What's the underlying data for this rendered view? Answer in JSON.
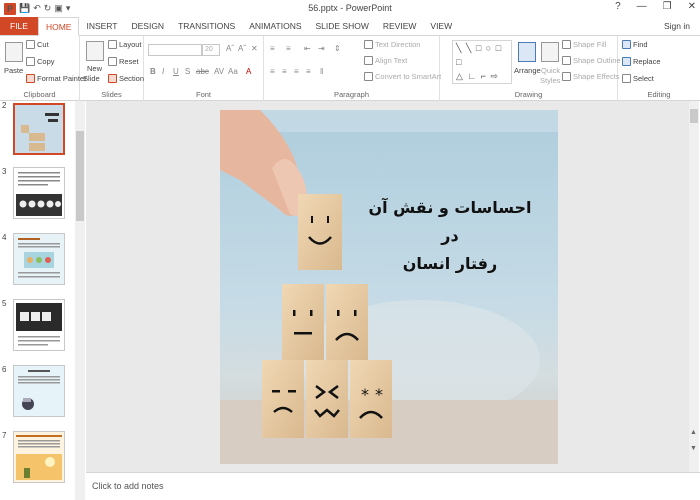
{
  "app": {
    "window_title": "56.pptx - PowerPoint",
    "logo_letter": "P",
    "controls": [
      "?",
      "—",
      "❐",
      "✕"
    ]
  },
  "tabs": [
    "FILE",
    "HOME",
    "INSERT",
    "DESIGN",
    "TRANSITIONS",
    "ANIMATIONS",
    "SLIDE SHOW",
    "REVIEW",
    "VIEW"
  ],
  "active_tab": "HOME",
  "signin": "Sign in",
  "ribbon": {
    "clipboard": {
      "paste": "Paste",
      "cut": "Cut",
      "copy": "Copy",
      "format_painter": "Format Painter",
      "label": "Clipboard"
    },
    "slides": {
      "new_slide": "New",
      "new_slide2": "Slide",
      "layout": "Layout",
      "reset": "Reset",
      "section": "Section",
      "label": "Slides"
    },
    "font": {
      "size": "20",
      "label": "Font",
      "b": "B",
      "i": "I",
      "u": "U",
      "s": "S",
      "abc": "abc",
      "av": "AV",
      "aa": "Aa",
      "a": "A"
    },
    "paragraph": {
      "text_direction": "Text Direction",
      "align_text": "Align Text",
      "smartart": "Convert to SmartArt",
      "label": "Paragraph"
    },
    "drawing": {
      "arrange": "Arrange",
      "quick_styles": "Quick",
      "quick_styles2": "Styles",
      "shape_fill": "Shape Fill",
      "shape_outline": "Shape Outline",
      "shape_effects": "Shape Effects",
      "label": "Drawing"
    },
    "editing": {
      "find": "Find",
      "replace": "Replace",
      "select": "Select",
      "label": "Editing"
    }
  },
  "thumbnails": [
    {
      "num": "2",
      "active": true
    },
    {
      "num": "3",
      "active": false
    },
    {
      "num": "4",
      "active": false
    },
    {
      "num": "5",
      "active": false
    },
    {
      "num": "6",
      "active": false
    },
    {
      "num": "7",
      "active": false
    }
  ],
  "slide": {
    "title_line1": "احساسات و نقش آن در",
    "title_line2": "رفتار انسان",
    "faces": [
      "◡",
      "– –",
      "⌣",
      "˙⌢",
      "> <",
      "* *"
    ]
  },
  "notes_placeholder": "Click to add notes",
  "colors": {
    "accent": "#d24726"
  }
}
